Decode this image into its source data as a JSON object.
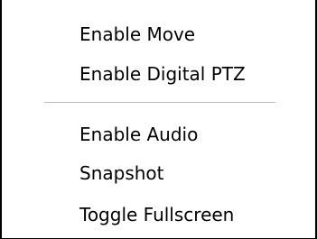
{
  "menu": {
    "items_group_1": [
      {
        "label": "Enable Move"
      },
      {
        "label": "Enable Digital PTZ"
      }
    ],
    "items_group_2": [
      {
        "label": "Enable Audio"
      },
      {
        "label": "Snapshot"
      },
      {
        "label": "Toggle Fullscreen"
      }
    ]
  },
  "colors": {
    "separator": "#a9d18e",
    "border": "#000000",
    "background": "#ffffff",
    "text": "#000000"
  }
}
